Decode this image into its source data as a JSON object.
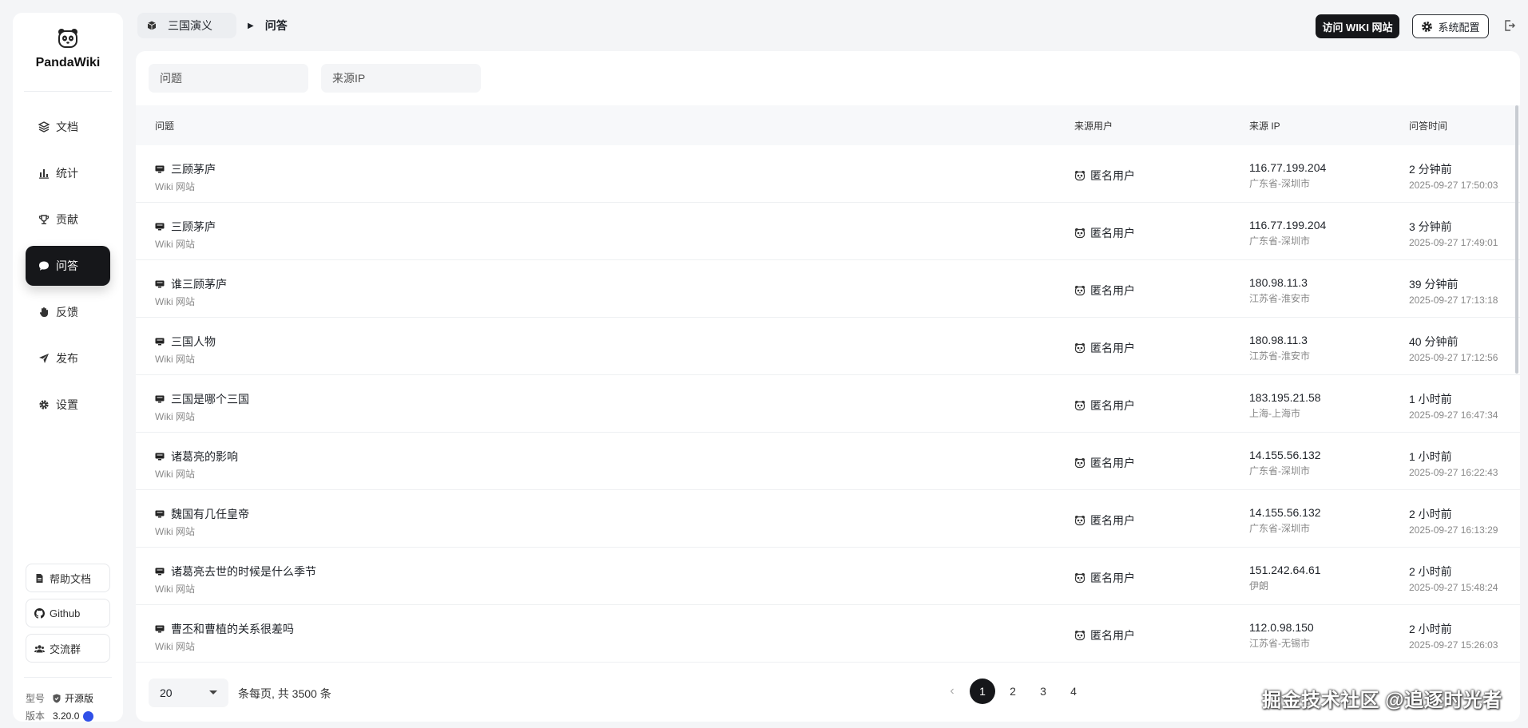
{
  "app": {
    "name": "PandaWiki"
  },
  "sidebar": {
    "items": [
      {
        "label": "文档",
        "icon": "layers-icon"
      },
      {
        "label": "统计",
        "icon": "bar-chart-icon"
      },
      {
        "label": "贡献",
        "icon": "trophy-icon"
      },
      {
        "label": "问答",
        "icon": "chat-bubble-icon",
        "active": true
      },
      {
        "label": "反馈",
        "icon": "hand-icon"
      },
      {
        "label": "发布",
        "icon": "send-icon"
      },
      {
        "label": "设置",
        "icon": "gear-icon"
      }
    ],
    "bottom": [
      {
        "label": "帮助文档",
        "icon": "document-icon"
      },
      {
        "label": "Github",
        "icon": "github-icon"
      },
      {
        "label": "交流群",
        "icon": "group-icon"
      }
    ],
    "version": {
      "type_label": "型号",
      "type_value": "开源版",
      "version_label": "版本",
      "version_value": "3.20.0"
    }
  },
  "header": {
    "breadcrumb": {
      "space": "三国演义",
      "current": "问答"
    },
    "visit_button": "访问 WIKI 网站",
    "config_button": "系统配置"
  },
  "filters": {
    "question_placeholder": "问题",
    "ip_placeholder": "来源IP"
  },
  "table": {
    "columns": {
      "question": "问题",
      "user": "来源用户",
      "ip": "来源 IP",
      "time": "问答时间"
    },
    "rows": [
      {
        "question": "三顾茅庐",
        "source": "Wiki 网站",
        "user": "匿名用户",
        "ip": "116.77.199.204",
        "location": "广东省-深圳市",
        "relative": "2 分钟前",
        "time": "2025-09-27 17:50:03"
      },
      {
        "question": "三顾茅庐",
        "source": "Wiki 网站",
        "user": "匿名用户",
        "ip": "116.77.199.204",
        "location": "广东省-深圳市",
        "relative": "3 分钟前",
        "time": "2025-09-27 17:49:01"
      },
      {
        "question": "谁三顾茅庐",
        "source": "Wiki 网站",
        "user": "匿名用户",
        "ip": "180.98.11.3",
        "location": "江苏省-淮安市",
        "relative": "39 分钟前",
        "time": "2025-09-27 17:13:18"
      },
      {
        "question": "三国人物",
        "source": "Wiki 网站",
        "user": "匿名用户",
        "ip": "180.98.11.3",
        "location": "江苏省-淮安市",
        "relative": "40 分钟前",
        "time": "2025-09-27 17:12:56"
      },
      {
        "question": "三国是哪个三国",
        "source": "Wiki 网站",
        "user": "匿名用户",
        "ip": "183.195.21.58",
        "location": "上海-上海市",
        "relative": "1 小时前",
        "time": "2025-09-27 16:47:34"
      },
      {
        "question": "诸葛亮的影响",
        "source": "Wiki 网站",
        "user": "匿名用户",
        "ip": "14.155.56.132",
        "location": "广东省-深圳市",
        "relative": "1 小时前",
        "time": "2025-09-27 16:22:43"
      },
      {
        "question": "魏国有几任皇帝",
        "source": "Wiki 网站",
        "user": "匿名用户",
        "ip": "14.155.56.132",
        "location": "广东省-深圳市",
        "relative": "2 小时前",
        "time": "2025-09-27 16:13:29"
      },
      {
        "question": "诸葛亮去世的时候是什么季节",
        "source": "Wiki 网站",
        "user": "匿名用户",
        "ip": "151.242.64.61",
        "location": "伊朗",
        "relative": "2 小时前",
        "time": "2025-09-27 15:48:24"
      },
      {
        "question": "曹丕和曹植的关系很差吗",
        "source": "Wiki 网站",
        "user": "匿名用户",
        "ip": "112.0.98.150",
        "location": "江苏省-无锡市",
        "relative": "2 小时前",
        "time": "2025-09-27 15:26:03"
      }
    ]
  },
  "pagination": {
    "page_size": "20",
    "summary": "条每页, 共 3500 条",
    "pages": [
      "1",
      "2",
      "3",
      "4"
    ],
    "current": "1"
  },
  "watermark": "掘金技术社区 @追逐时光者"
}
